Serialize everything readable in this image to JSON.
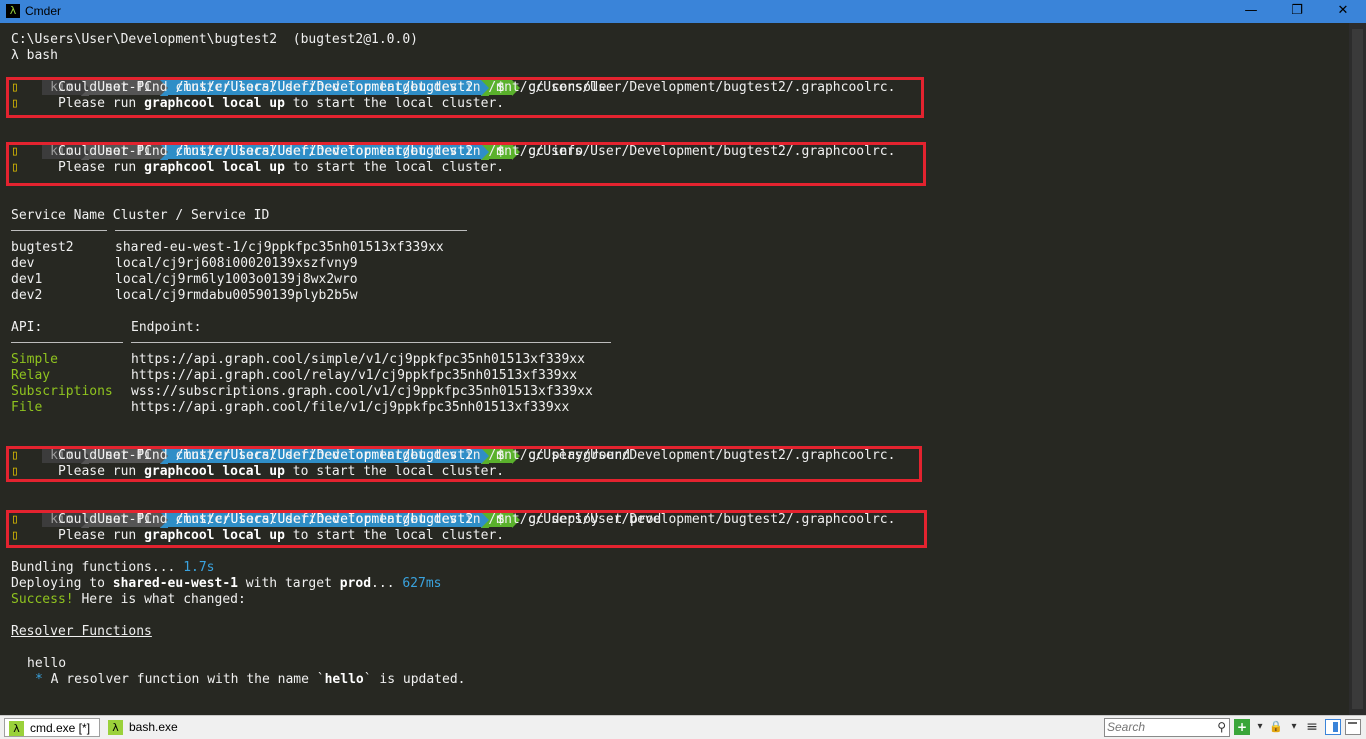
{
  "window": {
    "title": "Cmder",
    "minimize_glyph": "—",
    "maximize_glyph": "❐",
    "close_glyph": "✕"
  },
  "terminal": {
    "cwd_line": "C:\\Users\\User\\Development\\bugtest2  (bugtest2@1.0.0)",
    "shell_line": "λ bash",
    "prompt": {
      "user": " kim ",
      "host": " User-PC ",
      "path": " /mnt/c/Users/User/Development/bugtest2 ",
      "dollar": " $ "
    },
    "commands": {
      "console": "gc console",
      "info": "gc info",
      "playground": "gc playground",
      "deploy": "gc deploy -t prod"
    },
    "error": {
      "icon": "▯",
      "line1": "Could not find cluster local defined for target dev in /mnt/c/Users/User/Development/bugtest2/.graphcoolrc.",
      "line2_pre": "Please run ",
      "line2_cmd": "graphcool local up",
      "line2_post": " to start the local cluster."
    },
    "services": {
      "header_name": "Service Name",
      "header_id": "Cluster / Service ID",
      "rows": [
        {
          "name": "bugtest2",
          "id": "shared-eu-west-1/cj9ppkfpc35nh01513xf339xx"
        },
        {
          "name": "dev",
          "id": "local/cj9rj608i00020139xszfvny9"
        },
        {
          "name": "dev1",
          "id": "local/cj9rm6ly1003o0139j8wx2wro"
        },
        {
          "name": "dev2",
          "id": "local/cj9rmdabu00590139plyb2b5w"
        }
      ]
    },
    "api": {
      "header_api": "API:",
      "header_endpoint": "Endpoint:",
      "rows": [
        {
          "name": "Simple",
          "url": "https://api.graph.cool/simple/v1/cj9ppkfpc35nh01513xf339xx"
        },
        {
          "name": "Relay",
          "url": "https://api.graph.cool/relay/v1/cj9ppkfpc35nh01513xf339xx"
        },
        {
          "name": "Subscriptions",
          "url": "wss://subscriptions.graph.cool/v1/cj9ppkfpc35nh01513xf339xx"
        },
        {
          "name": "File",
          "url": "https://api.graph.cool/file/v1/cj9ppkfpc35nh01513xf339xx"
        }
      ]
    },
    "deploy": {
      "bundling": "Bundling functions... ",
      "bundling_time": "1.7s",
      "deploying_pre": "Deploying to ",
      "deploying_region": "shared-eu-west-1",
      "deploying_mid": " with target ",
      "deploying_target": "prod",
      "deploying_post": "... ",
      "deploying_time": "627ms",
      "success_label": "Success!",
      "success_rest": " Here is what changed:",
      "section_title": "Resolver Functions",
      "function_name": "hello",
      "change_bullet": "*",
      "change_pre": " A resolver function with the name `",
      "change_name": "hello",
      "change_post": "` is updated."
    }
  },
  "statusbar": {
    "tabs": [
      {
        "label": "cmd.exe [*]",
        "icon": "λ",
        "active": true
      },
      {
        "label": "bash.exe",
        "icon": "λ",
        "active": false
      }
    ],
    "search_placeholder": "Search",
    "search_icon": "⚲",
    "new_console_icon": "+",
    "dropdown_icon": "▾",
    "lock_icon": "🔒",
    "menu_icon": "≡"
  },
  "colors": {
    "titlebar": "#3a84d9",
    "terminal_bg": "#272822",
    "highlight_box": "#e3232f",
    "green": "#8fc31f",
    "blue": "#3aa3df"
  }
}
